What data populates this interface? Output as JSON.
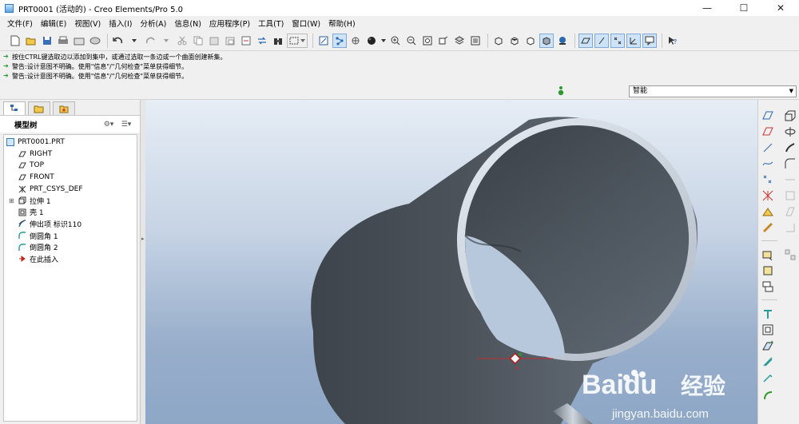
{
  "window": {
    "title": "PRT0001 (活动的) - Creo Elements/Pro 5.0",
    "controls": [
      "—",
      "☐",
      "✕"
    ]
  },
  "menu": [
    "文件(F)",
    "编辑(E)",
    "视图(V)",
    "插入(I)",
    "分析(A)",
    "信息(N)",
    "应用程序(P)",
    "工具(T)",
    "窗口(W)",
    "帮助(H)"
  ],
  "toolbar_icons": [
    "new-icon",
    "open-icon",
    "save-icon",
    "print-icon",
    "send-icon",
    "print-preview-icon",
    "undo-icon",
    "redo-icon",
    "cut-icon",
    "copy-icon",
    "paste-icon",
    "paste-special-icon",
    "regenerate-icon",
    "regen-manager-icon",
    "find-icon",
    "select-box-icon",
    "repaint-icon",
    "spin-center-icon",
    "orient-icon",
    "display-style-icon",
    "zoom-in-icon",
    "zoom-out-icon",
    "refit-icon",
    "reorient-icon",
    "saved-views-icon",
    "layers-icon",
    "wireframe-icon",
    "hidden-line-icon",
    "no-hidden-icon",
    "shading-icon",
    "enhanced-realism-icon",
    "datum-planes-toggle-icon",
    "datum-axes-toggle-icon",
    "datum-points-toggle-icon",
    "csys-toggle-icon",
    "annotations-toggle-icon",
    "context-help-icon"
  ],
  "messages": [
    "按住CTRL键选取边以添加到集中，或通过选取一条边或一个曲面创建新集。",
    "警告:设计意图不明确。使用\"信息\"/\"几何检查\"菜单获得细节。",
    "警告:设计意图不明确。使用\"信息\"/\"几何检查\"菜单获得细节。"
  ],
  "filter": {
    "value": "智能"
  },
  "model_tree": {
    "header": "模型树",
    "nodes": [
      {
        "label": "PRT0001.PRT",
        "icon": "part-icon",
        "indent": 0
      },
      {
        "label": "RIGHT",
        "icon": "datum-plane-icon",
        "indent": 1
      },
      {
        "label": "TOP",
        "icon": "datum-plane-icon",
        "indent": 1
      },
      {
        "label": "FRONT",
        "icon": "datum-plane-icon",
        "indent": 1
      },
      {
        "label": "PRT_CSYS_DEF",
        "icon": "csys-icon",
        "indent": 1
      },
      {
        "label": "拉伸 1",
        "icon": "extrude-icon",
        "indent": 1,
        "expandable": true
      },
      {
        "label": "壳 1",
        "icon": "shell-icon",
        "indent": 1
      },
      {
        "label": "伸出项 标识110",
        "icon": "protrusion-icon",
        "indent": 1
      },
      {
        "label": "倒圆角 1",
        "icon": "round-icon",
        "indent": 1
      },
      {
        "label": "倒圆角 2",
        "icon": "round-icon",
        "indent": 1
      },
      {
        "label": "在此插入",
        "icon": "insert-here-icon",
        "indent": 1
      }
    ]
  },
  "right_toolbar_icons": [
    "datum-plane-icon",
    "datum-axis-icon",
    "datum-curve-icon",
    "datum-point-icon",
    "csys-icon",
    "sketch-icon",
    "extrude-icon",
    "revolve-icon",
    "sweep-icon",
    "blend-icon",
    "hole-icon",
    "shell-icon",
    "rib-icon",
    "draft-icon",
    "round-icon",
    "chamfer-icon",
    "mirror-icon",
    "merge-icon",
    "trim-icon",
    "pattern-icon",
    "offset-icon",
    "thicken-icon",
    "solidify-icon"
  ],
  "watermark": {
    "brand": "Baidu",
    "cn": "经验",
    "url": "jingyan.baidu.com"
  }
}
